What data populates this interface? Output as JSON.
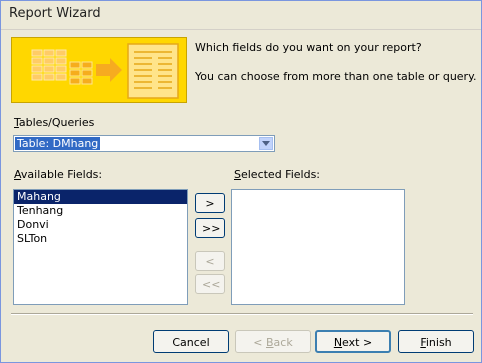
{
  "window": {
    "title": "Report Wizard"
  },
  "header": {
    "question": "Which fields do you want on your report?",
    "hint": "You can choose from more than one table or query."
  },
  "tables": {
    "label_prefix": "T",
    "label_rest": "ables/Queries",
    "selected": "Table: DMhang"
  },
  "available": {
    "label_prefix": "A",
    "label_rest": "vailable Fields:",
    "items": [
      "Mahang",
      "Tenhang",
      "Donvi",
      "SLTon"
    ],
    "selected_index": 0
  },
  "selected_fields": {
    "label_prefix": "S",
    "label_rest": "elected Fields:",
    "items": []
  },
  "transfer": {
    "add_one": ">",
    "add_all": ">>",
    "remove_one": "<",
    "remove_all": "<<"
  },
  "footer": {
    "cancel": "Cancel",
    "back_prefix": "< ",
    "back_accel": "B",
    "back_rest": "ack",
    "next_accel": "N",
    "next_rest": "ext >",
    "finish_accel": "F",
    "finish_rest": "inish"
  },
  "colors": {
    "window_bg": "#ece9d8",
    "selection": "#0a246a",
    "combo_selection": "#316ac5",
    "banner": "#ffd700"
  },
  "icons": [
    "report-wizard-banner-icon",
    "chevron-down-icon"
  ]
}
